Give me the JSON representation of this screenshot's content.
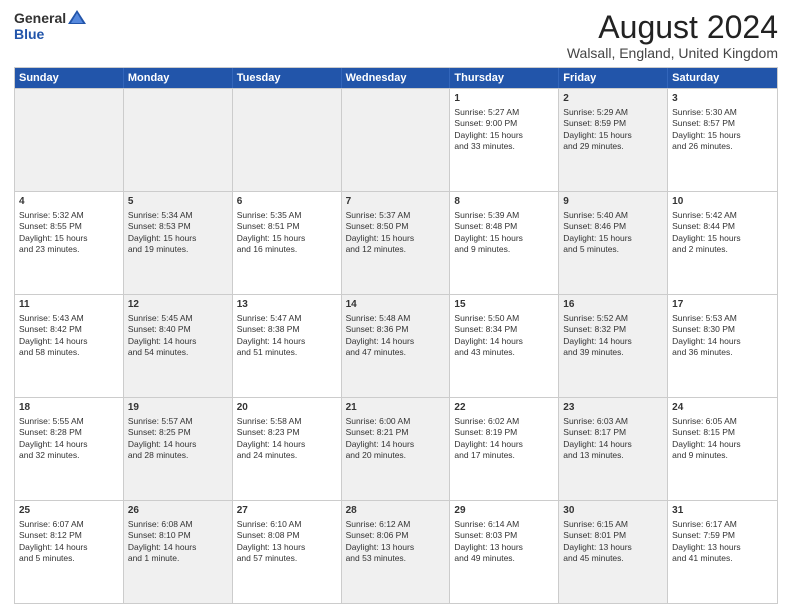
{
  "header": {
    "logo_general": "General",
    "logo_blue": "Blue",
    "title": "August 2024",
    "subtitle": "Walsall, England, United Kingdom"
  },
  "days": [
    "Sunday",
    "Monday",
    "Tuesday",
    "Wednesday",
    "Thursday",
    "Friday",
    "Saturday"
  ],
  "weeks": [
    [
      {
        "day": "",
        "text": "",
        "shaded": true
      },
      {
        "day": "",
        "text": "",
        "shaded": true
      },
      {
        "day": "",
        "text": "",
        "shaded": true
      },
      {
        "day": "",
        "text": "",
        "shaded": true
      },
      {
        "day": "1",
        "text": "Sunrise: 5:27 AM\nSunset: 9:00 PM\nDaylight: 15 hours\nand 33 minutes.",
        "shaded": false
      },
      {
        "day": "2",
        "text": "Sunrise: 5:29 AM\nSunset: 8:59 PM\nDaylight: 15 hours\nand 29 minutes.",
        "shaded": true
      },
      {
        "day": "3",
        "text": "Sunrise: 5:30 AM\nSunset: 8:57 PM\nDaylight: 15 hours\nand 26 minutes.",
        "shaded": false
      }
    ],
    [
      {
        "day": "4",
        "text": "Sunrise: 5:32 AM\nSunset: 8:55 PM\nDaylight: 15 hours\nand 23 minutes.",
        "shaded": false
      },
      {
        "day": "5",
        "text": "Sunrise: 5:34 AM\nSunset: 8:53 PM\nDaylight: 15 hours\nand 19 minutes.",
        "shaded": true
      },
      {
        "day": "6",
        "text": "Sunrise: 5:35 AM\nSunset: 8:51 PM\nDaylight: 15 hours\nand 16 minutes.",
        "shaded": false
      },
      {
        "day": "7",
        "text": "Sunrise: 5:37 AM\nSunset: 8:50 PM\nDaylight: 15 hours\nand 12 minutes.",
        "shaded": true
      },
      {
        "day": "8",
        "text": "Sunrise: 5:39 AM\nSunset: 8:48 PM\nDaylight: 15 hours\nand 9 minutes.",
        "shaded": false
      },
      {
        "day": "9",
        "text": "Sunrise: 5:40 AM\nSunset: 8:46 PM\nDaylight: 15 hours\nand 5 minutes.",
        "shaded": true
      },
      {
        "day": "10",
        "text": "Sunrise: 5:42 AM\nSunset: 8:44 PM\nDaylight: 15 hours\nand 2 minutes.",
        "shaded": false
      }
    ],
    [
      {
        "day": "11",
        "text": "Sunrise: 5:43 AM\nSunset: 8:42 PM\nDaylight: 14 hours\nand 58 minutes.",
        "shaded": false
      },
      {
        "day": "12",
        "text": "Sunrise: 5:45 AM\nSunset: 8:40 PM\nDaylight: 14 hours\nand 54 minutes.",
        "shaded": true
      },
      {
        "day": "13",
        "text": "Sunrise: 5:47 AM\nSunset: 8:38 PM\nDaylight: 14 hours\nand 51 minutes.",
        "shaded": false
      },
      {
        "day": "14",
        "text": "Sunrise: 5:48 AM\nSunset: 8:36 PM\nDaylight: 14 hours\nand 47 minutes.",
        "shaded": true
      },
      {
        "day": "15",
        "text": "Sunrise: 5:50 AM\nSunset: 8:34 PM\nDaylight: 14 hours\nand 43 minutes.",
        "shaded": false
      },
      {
        "day": "16",
        "text": "Sunrise: 5:52 AM\nSunset: 8:32 PM\nDaylight: 14 hours\nand 39 minutes.",
        "shaded": true
      },
      {
        "day": "17",
        "text": "Sunrise: 5:53 AM\nSunset: 8:30 PM\nDaylight: 14 hours\nand 36 minutes.",
        "shaded": false
      }
    ],
    [
      {
        "day": "18",
        "text": "Sunrise: 5:55 AM\nSunset: 8:28 PM\nDaylight: 14 hours\nand 32 minutes.",
        "shaded": false
      },
      {
        "day": "19",
        "text": "Sunrise: 5:57 AM\nSunset: 8:25 PM\nDaylight: 14 hours\nand 28 minutes.",
        "shaded": true
      },
      {
        "day": "20",
        "text": "Sunrise: 5:58 AM\nSunset: 8:23 PM\nDaylight: 14 hours\nand 24 minutes.",
        "shaded": false
      },
      {
        "day": "21",
        "text": "Sunrise: 6:00 AM\nSunset: 8:21 PM\nDaylight: 14 hours\nand 20 minutes.",
        "shaded": true
      },
      {
        "day": "22",
        "text": "Sunrise: 6:02 AM\nSunset: 8:19 PM\nDaylight: 14 hours\nand 17 minutes.",
        "shaded": false
      },
      {
        "day": "23",
        "text": "Sunrise: 6:03 AM\nSunset: 8:17 PM\nDaylight: 14 hours\nand 13 minutes.",
        "shaded": true
      },
      {
        "day": "24",
        "text": "Sunrise: 6:05 AM\nSunset: 8:15 PM\nDaylight: 14 hours\nand 9 minutes.",
        "shaded": false
      }
    ],
    [
      {
        "day": "25",
        "text": "Sunrise: 6:07 AM\nSunset: 8:12 PM\nDaylight: 14 hours\nand 5 minutes.",
        "shaded": false
      },
      {
        "day": "26",
        "text": "Sunrise: 6:08 AM\nSunset: 8:10 PM\nDaylight: 14 hours\nand 1 minute.",
        "shaded": true
      },
      {
        "day": "27",
        "text": "Sunrise: 6:10 AM\nSunset: 8:08 PM\nDaylight: 13 hours\nand 57 minutes.",
        "shaded": false
      },
      {
        "day": "28",
        "text": "Sunrise: 6:12 AM\nSunset: 8:06 PM\nDaylight: 13 hours\nand 53 minutes.",
        "shaded": true
      },
      {
        "day": "29",
        "text": "Sunrise: 6:14 AM\nSunset: 8:03 PM\nDaylight: 13 hours\nand 49 minutes.",
        "shaded": false
      },
      {
        "day": "30",
        "text": "Sunrise: 6:15 AM\nSunset: 8:01 PM\nDaylight: 13 hours\nand 45 minutes.",
        "shaded": true
      },
      {
        "day": "31",
        "text": "Sunrise: 6:17 AM\nSunset: 7:59 PM\nDaylight: 13 hours\nand 41 minutes.",
        "shaded": false
      }
    ]
  ]
}
